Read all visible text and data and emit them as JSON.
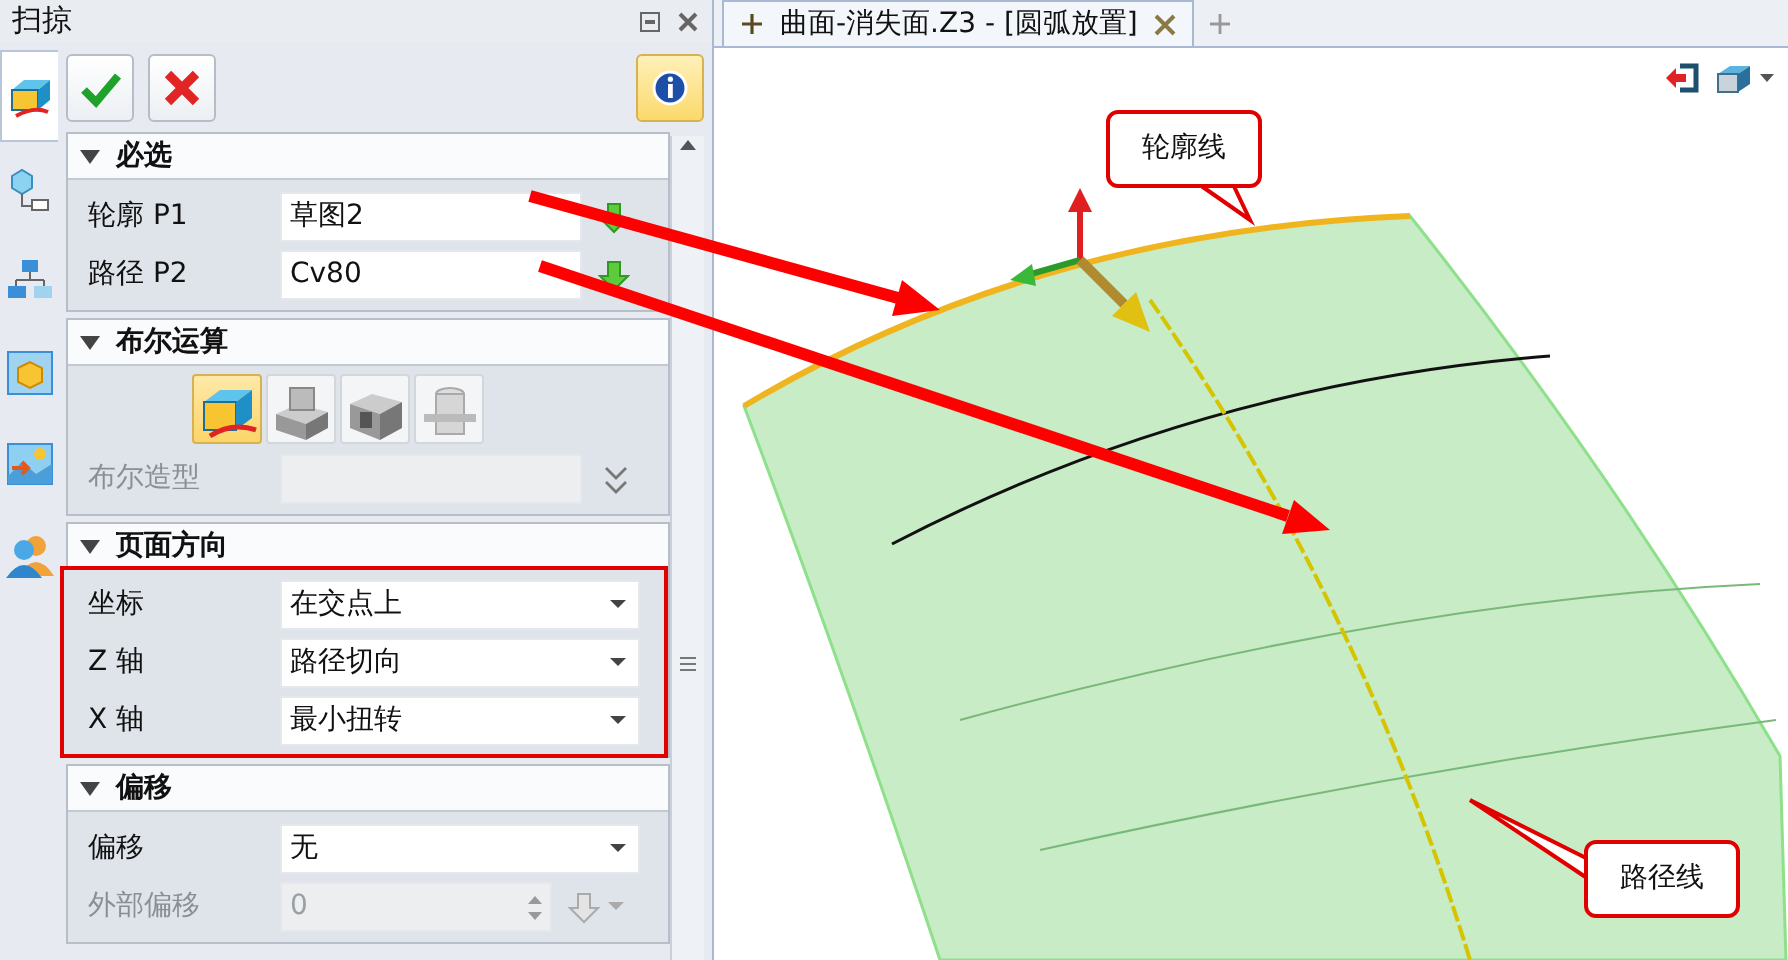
{
  "panel": {
    "title": "扫掠",
    "side_tabs": [
      {
        "selected": true
      },
      {
        "selected": false
      },
      {
        "selected": false
      },
      {
        "selected": false
      },
      {
        "selected": false
      },
      {
        "selected": false
      }
    ],
    "sections": [
      {
        "title": "必选",
        "expanded": true,
        "highlighted": false,
        "rows": [
          {
            "kind": "pick",
            "label": "轮廓 P1",
            "value": "草图2",
            "disabled": false
          },
          {
            "kind": "pick",
            "label": "路径 P2",
            "value": "Cv80",
            "disabled": false
          }
        ]
      },
      {
        "title": "布尔运算",
        "expanded": true,
        "highlighted": false,
        "rows": [
          {
            "kind": "boolean",
            "options": [
              {
                "selected": true
              },
              {
                "selected": false
              },
              {
                "selected": false
              },
              {
                "selected": false
              }
            ]
          },
          {
            "kind": "list",
            "label": "布尔造型",
            "disabled": true
          }
        ]
      },
      {
        "title": "页面方向",
        "expanded": true,
        "highlighted": true,
        "rows": [
          {
            "kind": "select",
            "label": "坐标",
            "value": "在交点上",
            "disabled": false
          },
          {
            "kind": "select",
            "label": "Z 轴",
            "value": "路径切向",
            "disabled": false
          },
          {
            "kind": "select",
            "label": "X 轴",
            "value": "最小扭转",
            "disabled": false
          }
        ]
      },
      {
        "title": "偏移",
        "expanded": true,
        "highlighted": false,
        "rows": [
          {
            "kind": "select",
            "label": "偏移",
            "value": "无",
            "disabled": false
          },
          {
            "kind": "spin",
            "label": "外部偏移",
            "value": "0",
            "disabled": true
          }
        ]
      }
    ]
  },
  "viewport": {
    "tab": {
      "title": "曲面-消失面.Z3 - [圆弧放置]",
      "selected": true
    },
    "callouts": [
      {
        "text": "轮廓线"
      },
      {
        "text": "路径线"
      }
    ]
  }
}
